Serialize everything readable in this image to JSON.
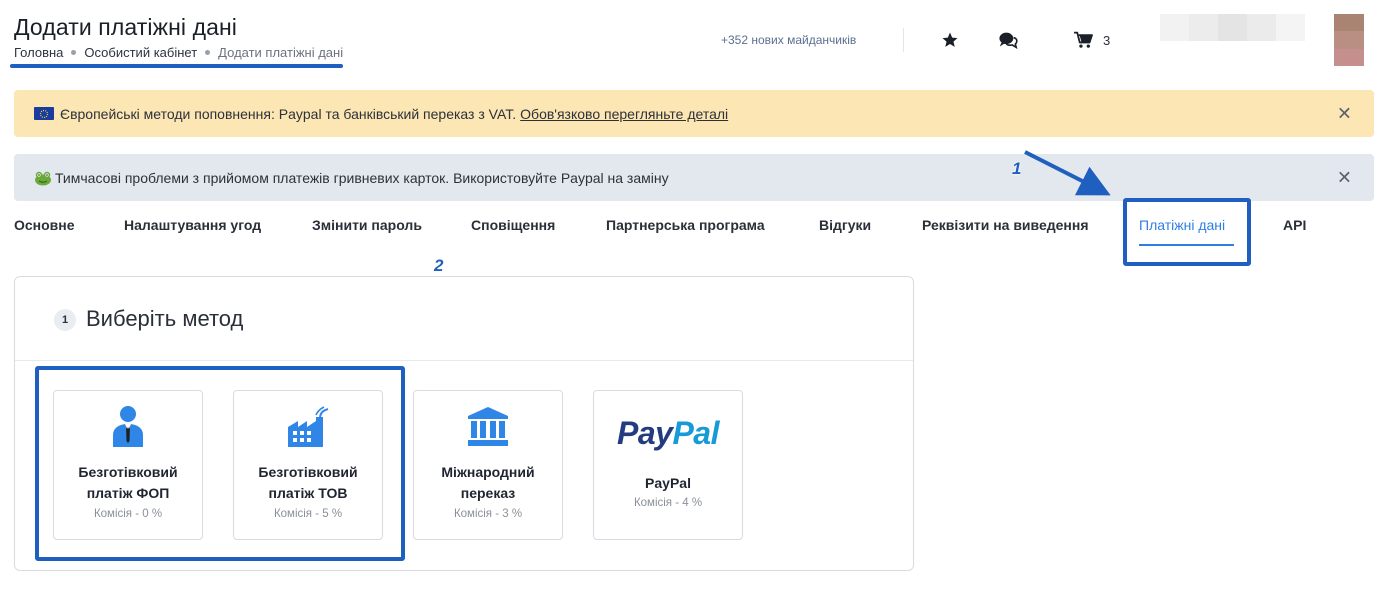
{
  "header": {
    "title": "Додати платіжні дані",
    "breadcrumb": [
      "Головна",
      "Особистий кабінет",
      "Додати платіжні дані"
    ],
    "new_sites": "+352 нових майданчиків",
    "cart_count": "3",
    "icons": [
      "star-icon",
      "chat-icon",
      "cart-icon"
    ]
  },
  "alerts": [
    {
      "text": "Європейські методи поповнення: Paypal та банківський переказ з VAT.",
      "link": "Обов'язково перегляньте деталі",
      "close": "✕",
      "color": "#fbe6b4"
    },
    {
      "text": "Тимчасові проблеми з прийомом платежів гривневих карток. Використовуйте Paypal на заміну",
      "close": "✕",
      "color": "#e3e8ee"
    }
  ],
  "tabs": [
    {
      "label": "Основне"
    },
    {
      "label": "Налаштування угод"
    },
    {
      "label": "Змінити пароль"
    },
    {
      "label": "Сповіщення"
    },
    {
      "label": "Партнерська програма"
    },
    {
      "label": "Відгуки"
    },
    {
      "label": "Реквізити на виведення"
    },
    {
      "label": "Платіжні дані",
      "active": true
    },
    {
      "label": "API"
    }
  ],
  "annotations": {
    "tab_marker": "1",
    "methods_marker": "2",
    "color": "#1f5fbf"
  },
  "section": {
    "step": "1",
    "title": "Виберіть метод",
    "methods": [
      {
        "title_line1": "Безготівковий",
        "title_line2": "платіж ФОП",
        "fee": "Комісія - 0 %",
        "icon": "person-icon"
      },
      {
        "title_line1": "Безготівковий",
        "title_line2": "платіж ТОВ",
        "fee": "Комісія - 5 %",
        "icon": "factory-icon"
      },
      {
        "title_line1": "Міжнародний",
        "title_line2": "переказ",
        "fee": "Комісія - 3 %",
        "icon": "bank-icon"
      },
      {
        "title_line1": "PayPal",
        "fee": "Комісія - 4 %",
        "icon": "paypal-logo",
        "logo_part1": "Pay",
        "logo_part2": "Pal"
      }
    ]
  },
  "colors": {
    "accent": "#2f7fe0",
    "icon_blue": "#2f86e6",
    "annotation": "#1f5fbf"
  }
}
